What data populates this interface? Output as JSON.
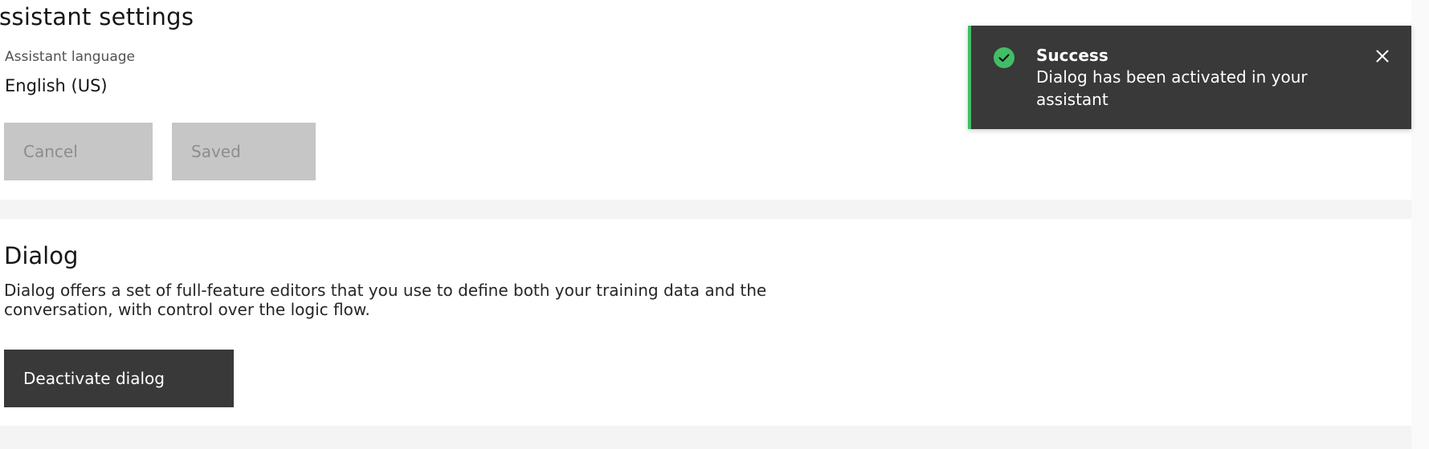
{
  "settings": {
    "title": "ssistant settings",
    "language_label": "Assistant language",
    "language_value": "English (US)",
    "cancel_label": "Cancel",
    "saved_label": "Saved"
  },
  "dialog_section": {
    "title": "Dialog",
    "description": "Dialog offers a set of full-feature editors that you use to define both your training data and the conversation, with control over the logic flow.",
    "deactivate_label": "Deactivate dialog"
  },
  "toast": {
    "kind": "success",
    "title": "Success",
    "subtitle": "Dialog has been activated in your assistant",
    "icon": "checkmark-filled-icon",
    "close_icon": "close-icon",
    "accent_color": "#42be65",
    "background_color": "#393939"
  },
  "colors": {
    "page_background": "#f4f4f4",
    "panel_background": "#ffffff",
    "disabled_button": "#c6c6c6",
    "disabled_text": "#8d8d8d",
    "primary_dark_button": "#393939"
  }
}
